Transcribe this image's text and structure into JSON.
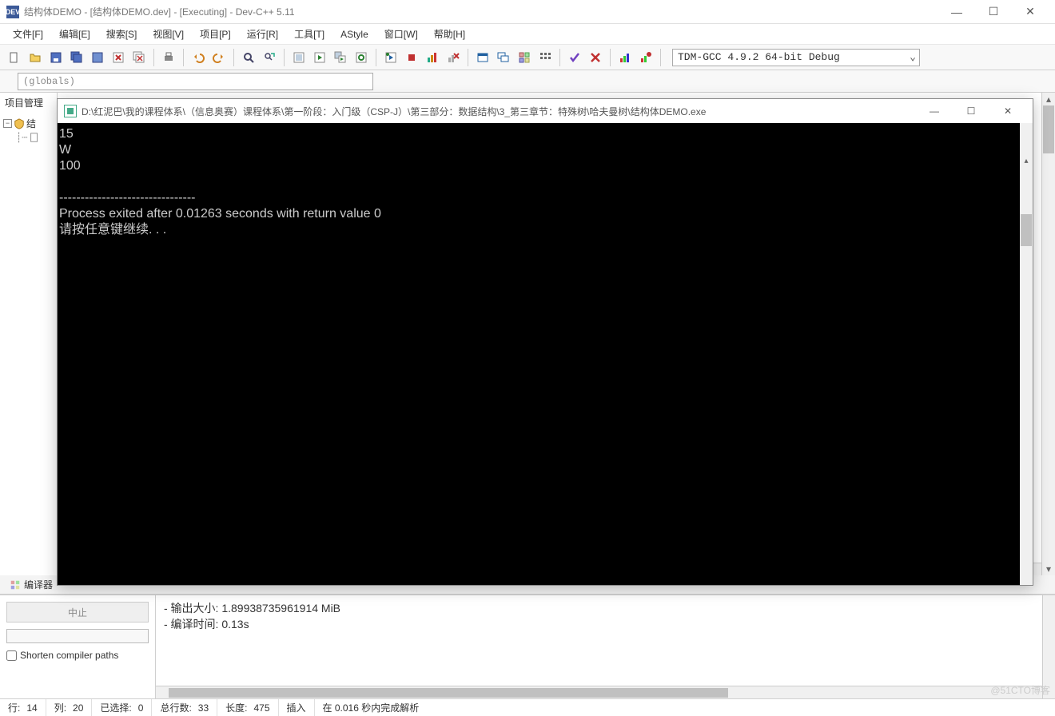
{
  "titlebar": {
    "app_name": "DEV",
    "title": "结构体DEMO - [结构体DEMO.dev] - [Executing] - Dev-C++ 5.11"
  },
  "menus": [
    "文件[F]",
    "编辑[E]",
    "搜索[S]",
    "视图[V]",
    "项目[P]",
    "运行[R]",
    "工具[T]",
    "AStyle",
    "窗口[W]",
    "帮助[H]"
  ],
  "compiler_combo": "TDM-GCC 4.9.2 64-bit Debug",
  "scope_combo": "(globals)",
  "sidebar": {
    "title": "项目管理",
    "root": "结",
    "child_icon": "file",
    "child": ""
  },
  "bottom_tabs": {
    "tab1": "编译器"
  },
  "bottom_left": {
    "stop": "中止",
    "shorten": "Shorten compiler paths"
  },
  "bottom_output": {
    "line1": "- 输出大小: 1.89938735961914 MiB",
    "line2": "- 编译时间: 0.13s"
  },
  "status": {
    "line_label": "行:",
    "line_val": "14",
    "col_label": "列:",
    "col_val": "20",
    "sel_label": "已选择:",
    "sel_val": "0",
    "total_label": "总行数:",
    "total_val": "33",
    "len_label": "长度:",
    "len_val": "475",
    "mode": "插入",
    "parse": "在 0.016 秒内完成解析"
  },
  "console": {
    "title": "D:\\红泥巴\\我的课程体系\\（信息奥赛）课程体系\\第一阶段：入门级（CSP-J）\\第三部分：数据结构\\3_第三章节：特殊树\\哈夫曼树\\结构体DEMO.exe",
    "lines": [
      "15",
      "W",
      "100",
      "",
      "--------------------------------",
      "Process exited after 0.01263 seconds with return value 0",
      "请按任意键继续. . ."
    ]
  },
  "watermark": "@51CTO博客"
}
